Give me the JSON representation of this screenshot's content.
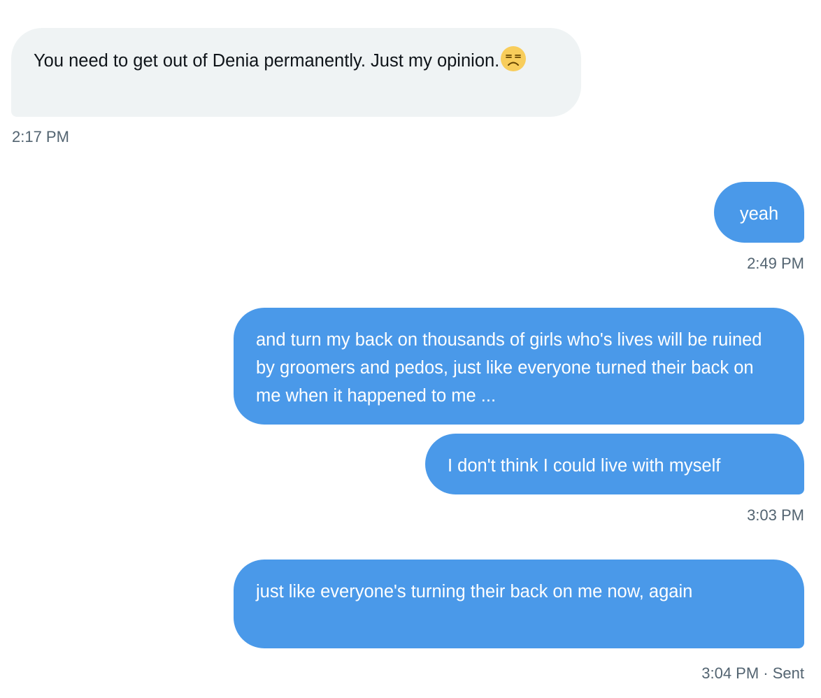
{
  "messages": [
    {
      "direction": "received",
      "text": "You need to get out of Denia permanently. Just my opinion.",
      "emoji": "unamused-face",
      "timestamp": "2:17 PM"
    },
    {
      "direction": "sent",
      "text": "yeah",
      "timestamp": "2:49 PM"
    },
    {
      "direction": "sent",
      "text": "and turn my back on thousands of girls who's lives will be ruined by groomers and pedos, just like everyone turned their back on me when it happened to me ..."
    },
    {
      "direction": "sent",
      "text": "I don't think I could live with myself",
      "timestamp": "3:03 PM"
    },
    {
      "direction": "sent",
      "text": "just like everyone's turning their back on me now, again",
      "timestamp": "3:04 PM · Sent"
    }
  ],
  "colors": {
    "sent_bubble": "#4a99e9",
    "received_bubble": "#eff3f4",
    "timestamp": "#536471"
  }
}
